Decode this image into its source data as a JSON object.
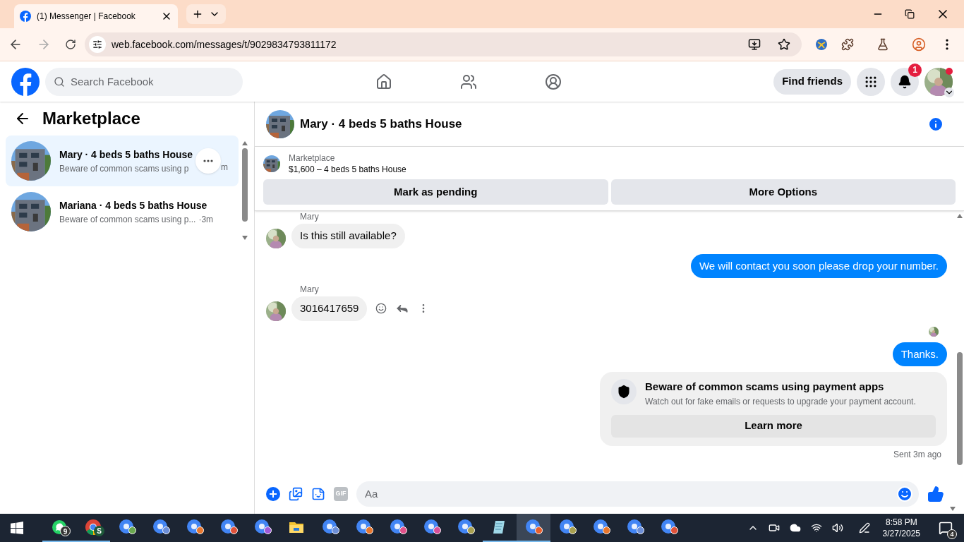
{
  "browser": {
    "tab": {
      "title": "(1) Messenger | Facebook",
      "selected": true
    },
    "url": "web.facebook.com/messages/t/9029834793811172"
  },
  "header": {
    "search": {
      "placeholder": "Search Facebook"
    },
    "nav": [
      {
        "kind": "home",
        "selected": false
      },
      {
        "kind": "friends",
        "selected": false
      },
      {
        "kind": "groups",
        "selected": false
      }
    ],
    "find_friends": "Find friends",
    "notifications_badge": "1"
  },
  "sidebar": {
    "title": "Marketplace",
    "conversations": [
      {
        "name": "Mary · 4 beds 5 baths House",
        "preview": "Beware of common scams using p",
        "time": "m",
        "selected": true
      },
      {
        "name": "Mariana · 4 beds 5 baths House",
        "preview": "Beware of common scams using p...",
        "time": "·3m",
        "selected": false
      }
    ]
  },
  "chat": {
    "title": "Mary · 4 beds 5 baths House",
    "listing": {
      "source": "Marketplace",
      "summary": "$1,600 – 4 beds 5 baths House"
    },
    "actions": [
      "Mark as pending",
      "More Options"
    ],
    "messages": [
      {
        "kind": "incoming",
        "sender": "Mary",
        "text": "Is this still available?"
      },
      {
        "kind": "outgoing",
        "text": "We will contact you soon please drop your number."
      },
      {
        "kind": "incoming",
        "sender": "Mary",
        "text": "3016417659",
        "hovered": true
      },
      {
        "kind": "seen"
      },
      {
        "kind": "outgoing",
        "text": "Thanks."
      },
      {
        "kind": "card",
        "title": "Beware of common scams using payment apps",
        "text": "Watch out for fake emails or requests to upgrade your payment account.",
        "button": "Learn more"
      },
      {
        "kind": "status",
        "text": "Sent 3m ago"
      }
    ],
    "composer": {
      "gif_label": "GIF",
      "placeholder": "Aa"
    }
  },
  "taskbar": {
    "apps": [
      {
        "kind": "whatsapp",
        "badge": "9",
        "running": true,
        "selected": false
      },
      {
        "kind": "chrome",
        "badge": "S",
        "running": true,
        "selected": false
      },
      {
        "kind": "profile",
        "color": "#6aa84f",
        "running": false,
        "selected": false
      },
      {
        "kind": "profile",
        "color": "#6d8fd8",
        "running": false,
        "selected": false
      },
      {
        "kind": "profile",
        "color": "#e8772e",
        "running": false,
        "selected": false
      },
      {
        "kind": "profile",
        "color": "#e0523a",
        "running": false,
        "selected": false
      },
      {
        "kind": "profile",
        "color": "#a05ad8",
        "running": false,
        "selected": false
      },
      {
        "kind": "folder",
        "running": false,
        "selected": false
      },
      {
        "kind": "profile",
        "color": "#6d8fd8",
        "running": false,
        "selected": false
      },
      {
        "kind": "profile",
        "color": "#e8772e",
        "running": false,
        "selected": false
      },
      {
        "kind": "profile",
        "color": "#e0528a",
        "running": false,
        "selected": false
      },
      {
        "kind": "profile",
        "color": "#d8509a",
        "running": false,
        "selected": false
      },
      {
        "kind": "profile",
        "color": "#a8a050",
        "running": false,
        "selected": false
      },
      {
        "kind": "notepad",
        "running": true,
        "selected": false
      },
      {
        "kind": "profile",
        "color": "#e8602e",
        "running": true,
        "selected": true
      },
      {
        "kind": "profile",
        "color": "#a8a050",
        "running": false,
        "selected": false
      },
      {
        "kind": "profile",
        "color": "#e8772e",
        "running": false,
        "selected": false
      },
      {
        "kind": "profile",
        "color": "#6d8fd8",
        "running": false,
        "selected": false
      },
      {
        "kind": "profile",
        "color": "#e0523a",
        "running": false,
        "selected": false
      }
    ],
    "time": "8:58 PM",
    "date": "3/27/2025",
    "notifications": "4"
  }
}
